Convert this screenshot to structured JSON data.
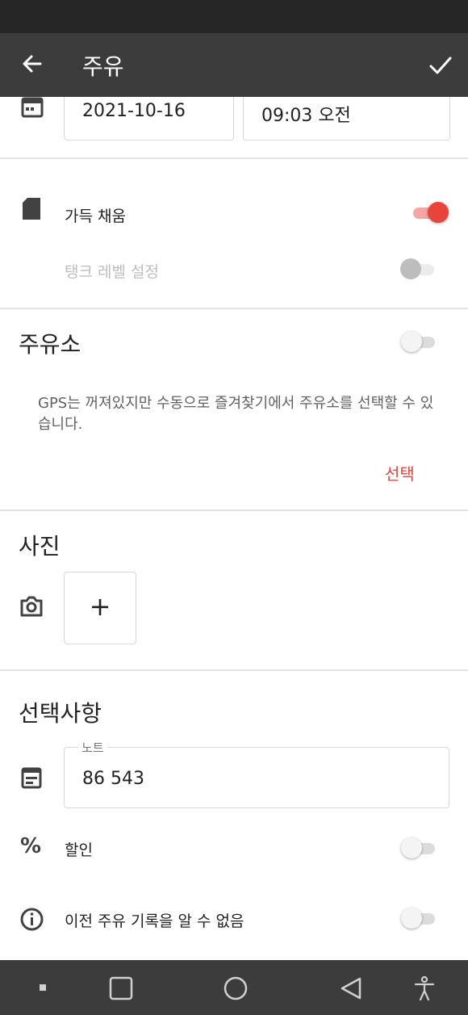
{
  "app_bar": {
    "title": "주유",
    "back_icon": "arrow-back-icon",
    "confirm_icon": "check-icon"
  },
  "datetime": {
    "calendar_icon": "calendar-icon",
    "date": "2021-10-16",
    "time": "09:03 오전"
  },
  "fuel": {
    "fuel_icon": "fuel-can-icon",
    "full_fill_label": "가득 채움",
    "full_fill_on": true,
    "tank_level_label": "탱크 레벨 설정",
    "tank_level_on": false
  },
  "station": {
    "title": "주유소",
    "toggle_on": false,
    "message": "GPS는 꺼져있지만 수동으로 즐겨찾기에서 주유소를 선택할 수 있습니다.",
    "select_label": "선택"
  },
  "photo": {
    "title": "사진",
    "camera_icon": "camera-icon",
    "add_label": "+"
  },
  "options": {
    "title": "선택사항",
    "note_icon": "note-icon",
    "note_label": "노트",
    "note_value": "86 543",
    "discount_icon": "percent-icon",
    "discount_label": "할인",
    "discount_on": false,
    "unknown_icon": "info-icon",
    "unknown_label": "이전 주유 기록을 알 수 없음",
    "unknown_on": false
  },
  "nav_bar": {
    "icons": [
      "dot-icon",
      "recents-icon",
      "home-icon",
      "back-triangle-icon",
      "accessibility-icon"
    ]
  },
  "colors": {
    "accent": "#e8443a",
    "app_bar": "#3c3c3c",
    "status_bar": "#262626"
  }
}
